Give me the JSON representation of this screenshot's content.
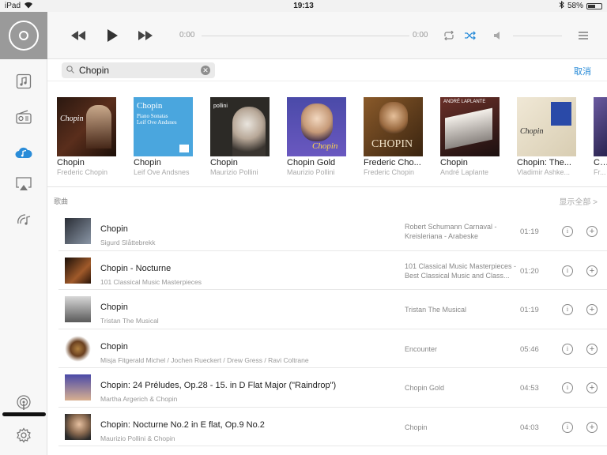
{
  "status_bar": {
    "device": "iPad",
    "time": "19:13",
    "battery": "58%",
    "battery_level": 0.58
  },
  "player": {
    "elapsed": "0:00",
    "remaining": "0:00"
  },
  "search": {
    "query": "Chopin",
    "cancel_label": "取消"
  },
  "albums": [
    {
      "title": "Chopin",
      "artist": "Frederic Chopin",
      "cover_text": "Chopin"
    },
    {
      "title": "Chopin",
      "artist": "Leif Ove Andsnes",
      "cover_text": "Chopin"
    },
    {
      "title": "Chopin",
      "artist": "Maurizio Pollini",
      "cover_text": "pollini"
    },
    {
      "title": "Chopin Gold",
      "artist": "Maurizio Pollini",
      "cover_text": "Chopin"
    },
    {
      "title": "Frederic Cho...",
      "artist": "Frederic Chopin",
      "cover_text": "CHOPIN"
    },
    {
      "title": "Chopin",
      "artist": "André Laplante",
      "cover_text": "ANDRÉ LAPLANTE"
    },
    {
      "title": "Chopin: The...",
      "artist": "Vladimir Ashke...",
      "cover_text": "Chopin"
    },
    {
      "title": "Ch...",
      "artist": "Fr...",
      "cover_text": ""
    }
  ],
  "songs_section": {
    "title": "歌曲",
    "show_all": "显示全部 >"
  },
  "songs": [
    {
      "title": "Chopin",
      "artist": "Sigurd Slåttebrekk",
      "album": "Robert Schumann Carnaval - Kreisleriana - Arabeske",
      "duration": "01:19"
    },
    {
      "title": "Chopin - Nocturne",
      "artist": "101 Classical Music Masterpieces",
      "album": "101 Classical Music Masterpieces - Best Classical Music and Class...",
      "duration": "01:20"
    },
    {
      "title": "Chopin",
      "artist": "Tristan The Musical",
      "album": "Tristan The Musical",
      "duration": "01:19"
    },
    {
      "title": "Chopin",
      "artist": "Misja Fitgerald Michel / Jochen Rueckert / Drew Gress / Ravi Coltrane",
      "album": "Encounter",
      "duration": "05:46"
    },
    {
      "title": "Chopin: 24 Préludes, Op.28 - 15. in D Flat Major (\"Raindrop\")",
      "artist": "Martha Argerich & Chopin",
      "album": "Chopin Gold",
      "duration": "04:53"
    },
    {
      "title": "Chopin: Nocturne No.2 in E flat, Op.9 No.2",
      "artist": "Maurizio Pollini & Chopin",
      "album": "Chopin",
      "duration": "04:03"
    }
  ]
}
